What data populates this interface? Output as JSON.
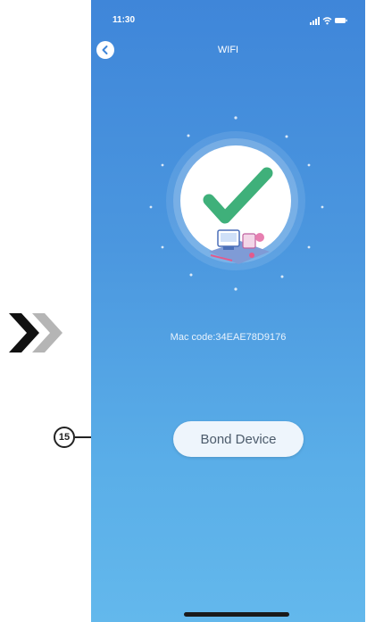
{
  "status_bar": {
    "time": "11:30"
  },
  "nav": {
    "title": "WIFI",
    "back_icon": "chevron-left-icon"
  },
  "hero": {
    "icon": "checkmark-icon",
    "illustration": "devices-illustration-icon"
  },
  "device": {
    "mac_label": "Mac code:",
    "mac_value": "34EAE78D9176"
  },
  "actions": {
    "bond_label": "Bond Device"
  },
  "annotations": {
    "callout_number": "15",
    "arrow_icon": "double-chevron-right-icon"
  },
  "colors": {
    "background_top": "#3f86d9",
    "background_bottom": "#63b8ec",
    "check_green": "#3fb07a",
    "button_bg": "#eef5fc"
  }
}
